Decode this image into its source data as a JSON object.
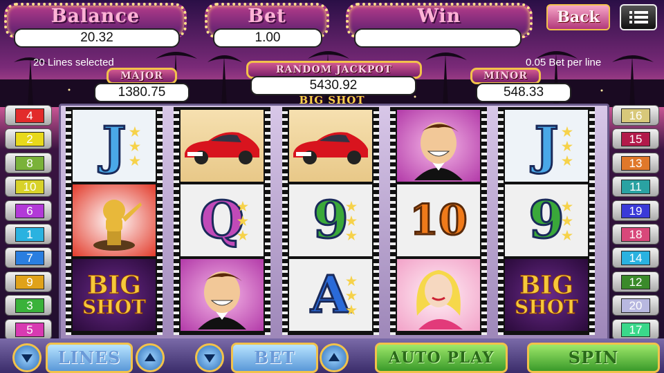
{
  "header": {
    "balance": {
      "label": "Balance",
      "value": "20.32"
    },
    "bet": {
      "label": "Bet",
      "value": "1.00"
    },
    "win": {
      "label": "Win",
      "value": ""
    },
    "back_label": "Back",
    "menu_icon": "hamburger-menu-icon"
  },
  "info": {
    "lines_selected": "20 Lines selected",
    "bet_per_line": "0.05 Bet per line"
  },
  "jackpots": {
    "major": {
      "label": "MAJOR",
      "value": "1380.75"
    },
    "random": {
      "label": "RANDOM JACKPOT",
      "value": "5430.92"
    },
    "minor": {
      "label": "MINOR",
      "value": "548.33"
    }
  },
  "game_title": "BIG SHOT",
  "paylines": {
    "left": [
      {
        "n": "4",
        "color": "#e22b2b"
      },
      {
        "n": "2",
        "color": "#e8d91b"
      },
      {
        "n": "8",
        "color": "#7ab23a"
      },
      {
        "n": "10",
        "color": "#d8d22a"
      },
      {
        "n": "6",
        "color": "#b23ad8"
      },
      {
        "n": "1",
        "color": "#2ab2e0"
      },
      {
        "n": "7",
        "color": "#2a7ee0"
      },
      {
        "n": "9",
        "color": "#e0a21a"
      },
      {
        "n": "3",
        "color": "#3ab23a"
      },
      {
        "n": "5",
        "color": "#d83ab2"
      }
    ],
    "right": [
      {
        "n": "16",
        "color": "#d8c87a"
      },
      {
        "n": "15",
        "color": "#b21a4a"
      },
      {
        "n": "13",
        "color": "#e0782a"
      },
      {
        "n": "11",
        "color": "#2aa2a2"
      },
      {
        "n": "19",
        "color": "#3a3ad8"
      },
      {
        "n": "18",
        "color": "#d8487a"
      },
      {
        "n": "14",
        "color": "#2ab2e0"
      },
      {
        "n": "12",
        "color": "#3a8a2a"
      },
      {
        "n": "20",
        "color": "#b8b8e0"
      },
      {
        "n": "17",
        "color": "#3ad88a"
      }
    ]
  },
  "reels": [
    [
      "J",
      "oscar-trophy",
      "BIG SHOT"
    ],
    [
      "red-sports-car",
      "Q",
      "tuxedo-man"
    ],
    [
      "red-sports-car",
      "9",
      "A"
    ],
    [
      "tuxedo-man",
      "10",
      "blonde-woman"
    ],
    [
      "J",
      "9",
      "BIG SHOT"
    ]
  ],
  "controls": {
    "lines_label": "LINES",
    "bet_label": "BET",
    "autoplay_label": "AUTO PLAY",
    "spin_label": "SPIN"
  }
}
